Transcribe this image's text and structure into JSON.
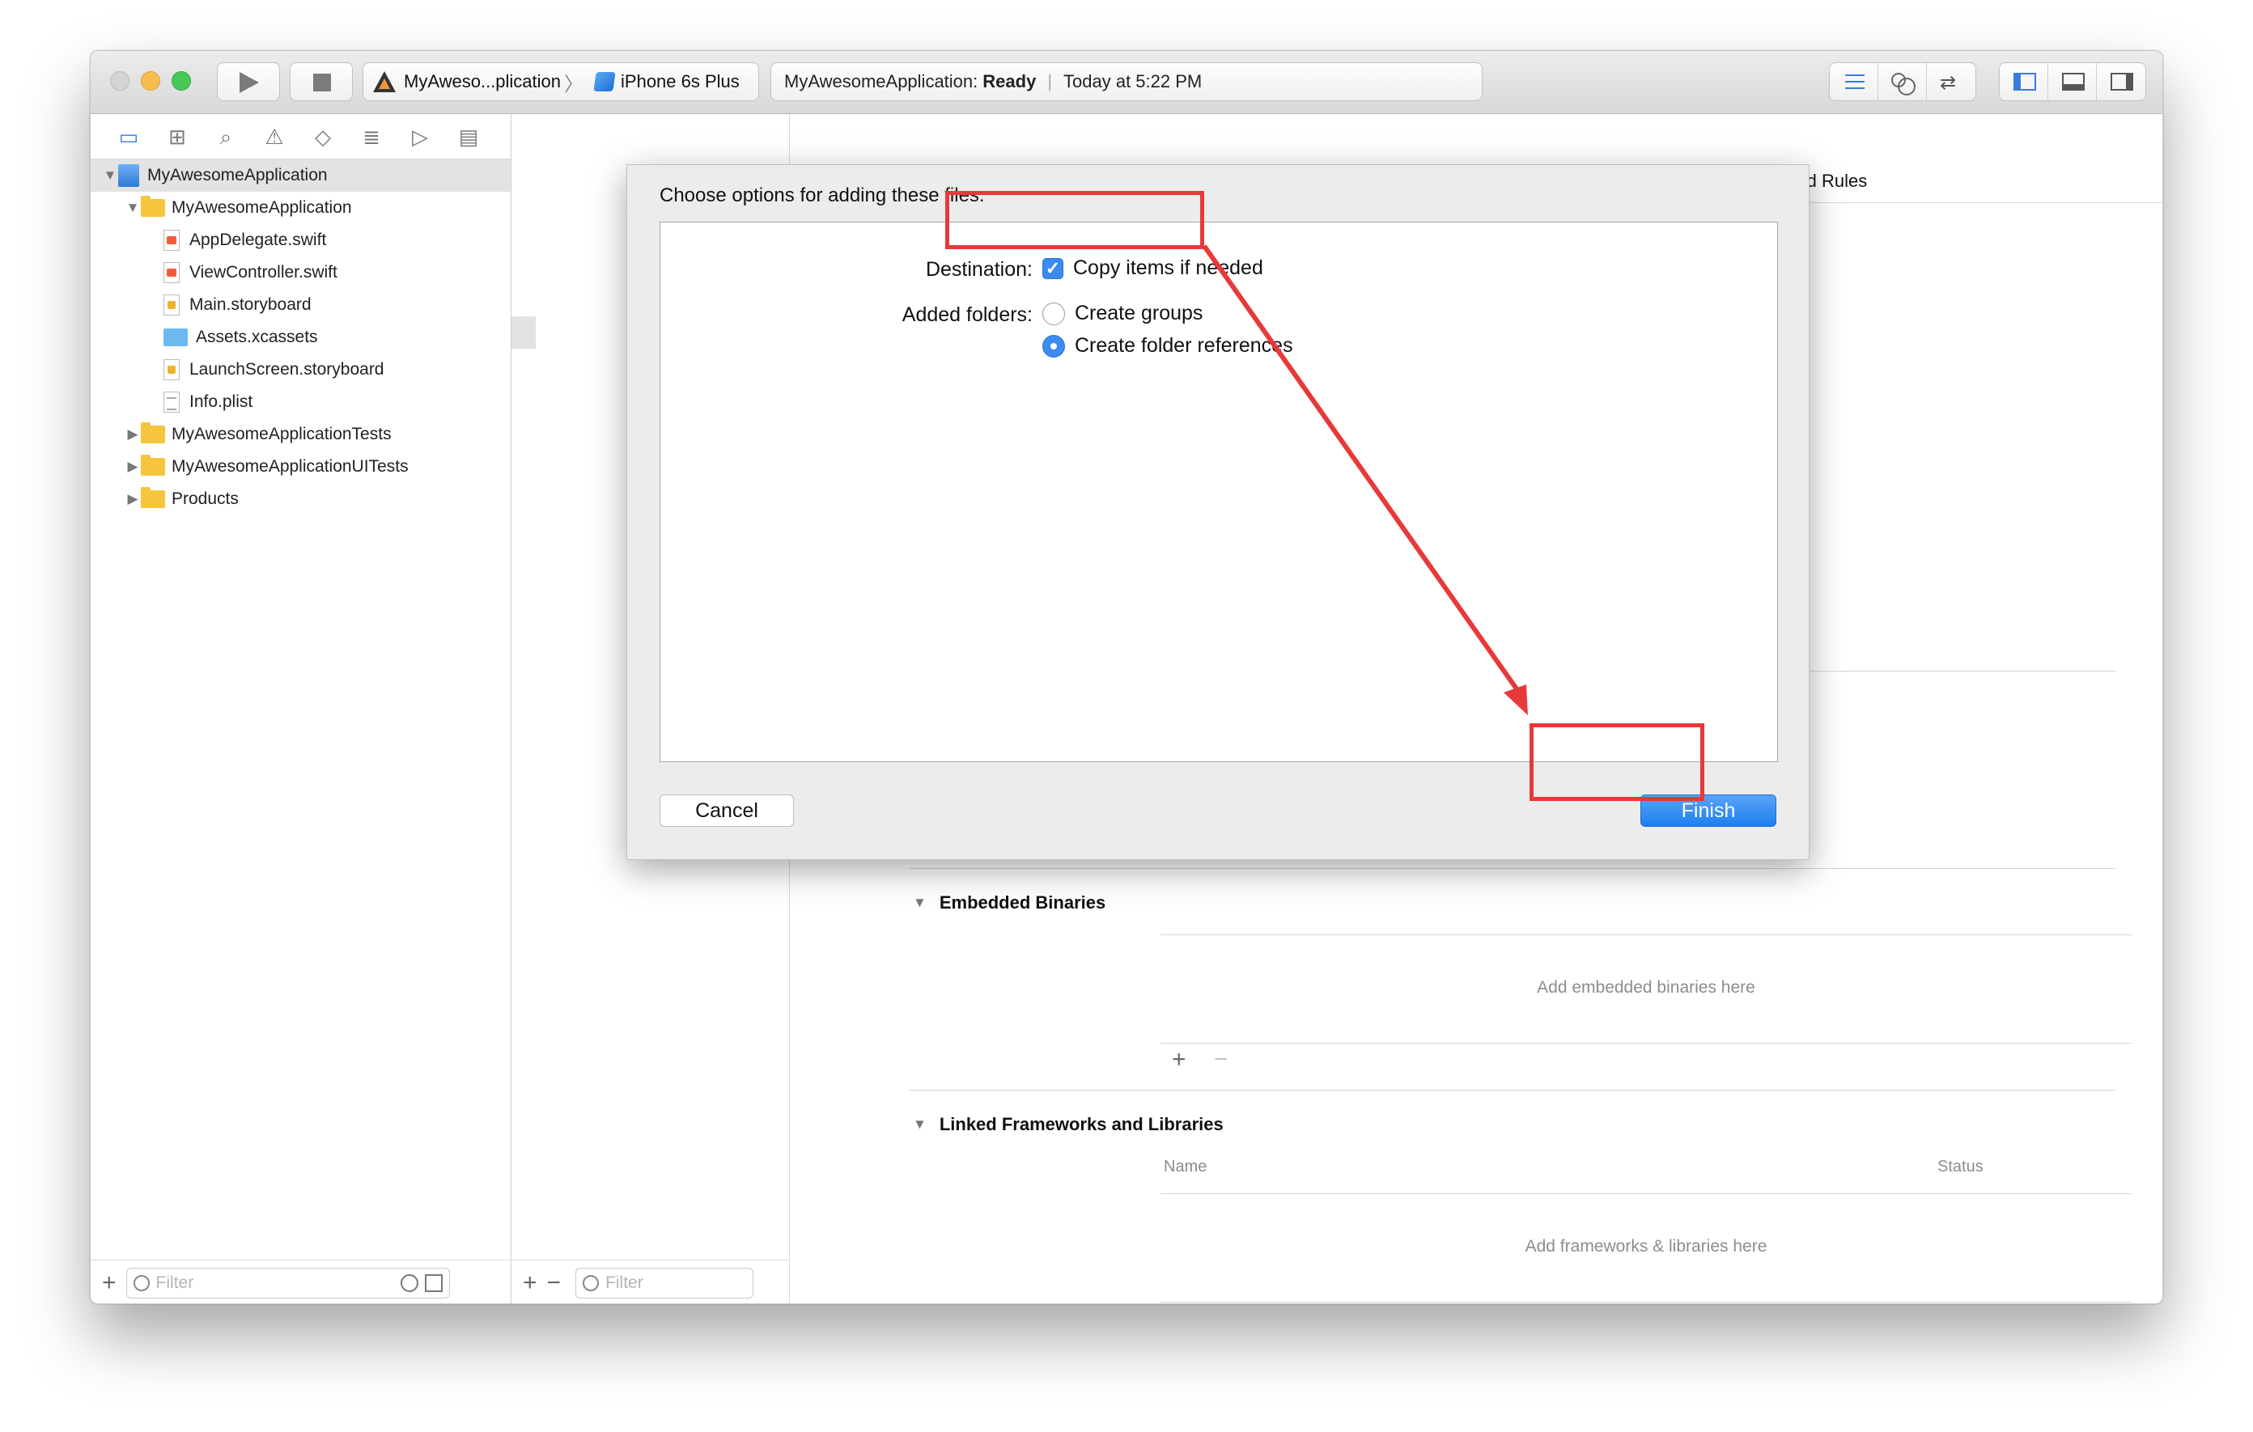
{
  "toolbar": {
    "scheme_app": "MyAweso...plication",
    "scheme_device": "iPhone 6s Plus",
    "activity_project": "MyAwesomeApplication:",
    "activity_status": "Ready",
    "activity_time": "Today at 5:22 PM"
  },
  "navigator": {
    "tree": [
      {
        "label": "MyAwesomeApplication",
        "kind": "project",
        "indent": 0,
        "disclosure": "▼",
        "selected": true
      },
      {
        "label": "MyAwesomeApplication",
        "kind": "folder",
        "indent": 1,
        "disclosure": "▼"
      },
      {
        "label": "AppDelegate.swift",
        "kind": "swift",
        "indent": 2
      },
      {
        "label": "ViewController.swift",
        "kind": "swift",
        "indent": 2
      },
      {
        "label": "Main.storyboard",
        "kind": "storyboard",
        "indent": 2
      },
      {
        "label": "Assets.xcassets",
        "kind": "xcassets",
        "indent": 2
      },
      {
        "label": "LaunchScreen.storyboard",
        "kind": "storyboard",
        "indent": 2
      },
      {
        "label": "Info.plist",
        "kind": "plist",
        "indent": 2
      },
      {
        "label": "MyAwesomeApplicationTests",
        "kind": "folder",
        "indent": 1,
        "disclosure": "▶"
      },
      {
        "label": "MyAwesomeApplicationUITests",
        "kind": "folder",
        "indent": 1,
        "disclosure": "▶"
      },
      {
        "label": "Products",
        "kind": "folder",
        "indent": 1,
        "disclosure": "▶"
      }
    ],
    "filter_placeholder": "Filter"
  },
  "targets": {
    "filter_placeholder": "Filter"
  },
  "editor": {
    "build_rules_tab": "Build Rules",
    "embedded_binaries": {
      "title": "Embedded Binaries",
      "placeholder": "Add embedded binaries here"
    },
    "linked_frameworks": {
      "title": "Linked Frameworks and Libraries",
      "col_name": "Name",
      "col_status": "Status",
      "placeholder": "Add frameworks & libraries here"
    }
  },
  "dialog": {
    "title": "Choose options for adding these files:",
    "destination_label": "Destination:",
    "copy_items_label": "Copy items if needed",
    "copy_items_checked": true,
    "added_folders_label": "Added folders:",
    "create_groups_label": "Create groups",
    "create_folder_refs_label": "Create folder references",
    "selected_folder_option": "Create folder references",
    "cancel_label": "Cancel",
    "finish_label": "Finish"
  },
  "colors": {
    "accent": "#3b8bf0",
    "annotation": "#e8393a",
    "folder": "#f5c53c"
  }
}
